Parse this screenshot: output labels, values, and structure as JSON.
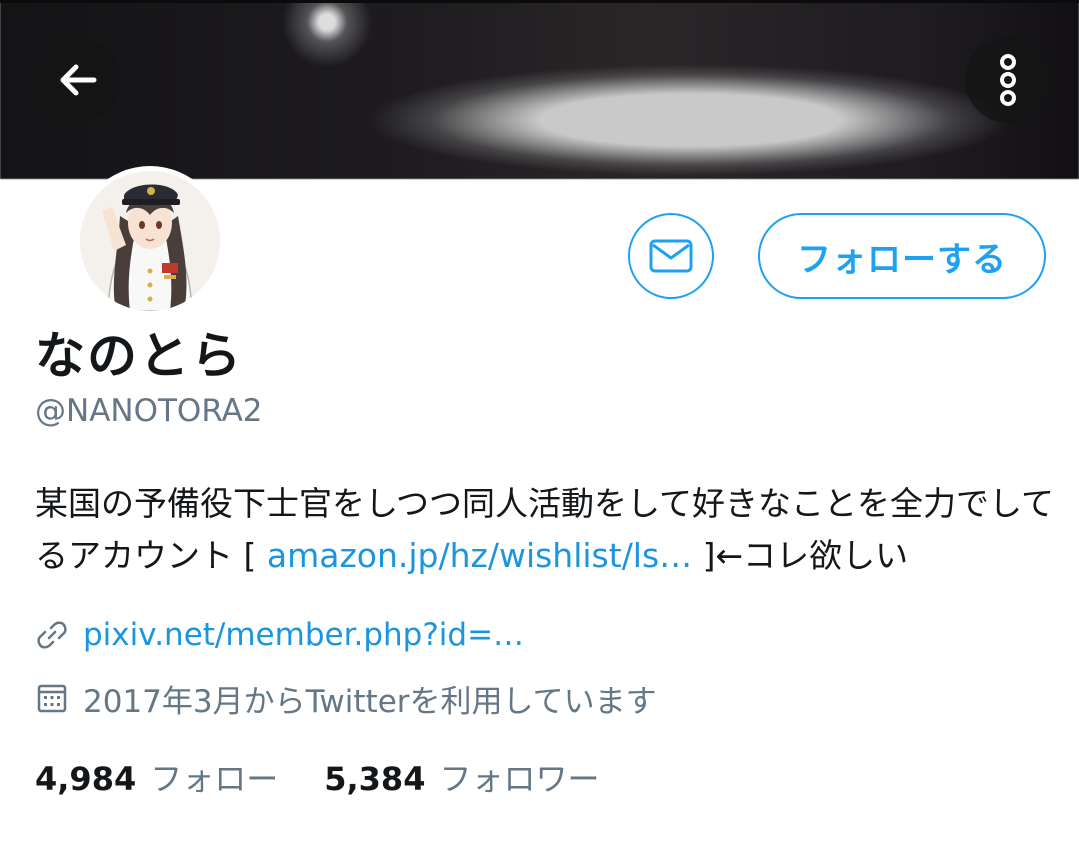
{
  "profile": {
    "display_name": "なのとら",
    "handle": "@NANOTORA2",
    "bio_text": "某国の予備役下士官をしつつ同人活動をして好きなことを全力でしてるアカウント [ ",
    "bio_link": "amazon.jp/hz/wishlist/ls…",
    "bio_suffix": " ]←コレ欲しい",
    "website": "pixiv.net/member.php?id=…",
    "joined": "2017年3月からTwitterを利用しています"
  },
  "actions": {
    "follow_label": "フォローする"
  },
  "stats": {
    "following_count": "4,984",
    "following_label": "フォロー",
    "followers_count": "5,384",
    "followers_label": "フォロワー"
  },
  "icons": {
    "back": "arrow-left-icon",
    "more": "more-vertical-icon",
    "message": "envelope-icon",
    "link": "link-icon",
    "calendar": "calendar-icon"
  },
  "colors": {
    "accent": "#1da1f2",
    "link": "#1b95e0",
    "muted": "#657786"
  }
}
